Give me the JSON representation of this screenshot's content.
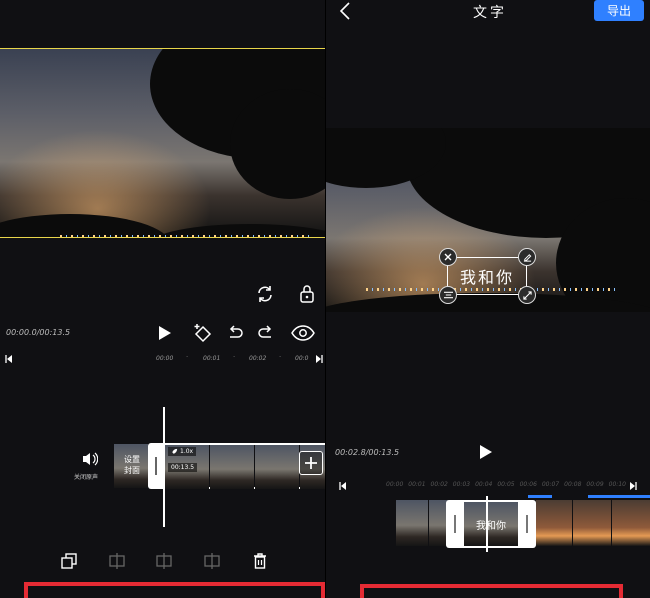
{
  "left": {
    "time_readout": "00:00.0/00:13.5",
    "ruler_ticks": [
      "00:00",
      "00:01",
      "00:02",
      "00:0"
    ],
    "audio_label": "关闭原声",
    "cover_label_line1": "设置",
    "cover_label_line2": "封面",
    "speed_badge": "1.0x",
    "clip_duration": "00:13.5"
  },
  "right": {
    "title": "文字",
    "export_label": "导出",
    "caption_text": "我和你",
    "time_readout": "00:02.8/00:13.5",
    "ruler_ticks": [
      "00:00",
      "00:01",
      "00:02",
      "00:03",
      "00:04",
      "00:05",
      "00:06",
      "00:07",
      "00:08",
      "00:09",
      "00:10"
    ],
    "track_text": "我和你"
  },
  "colors": {
    "accent_blue": "#2f80ff",
    "highlight_red": "#e52b34",
    "video_border_yellow": "#e8d54a",
    "background": "#101013"
  }
}
